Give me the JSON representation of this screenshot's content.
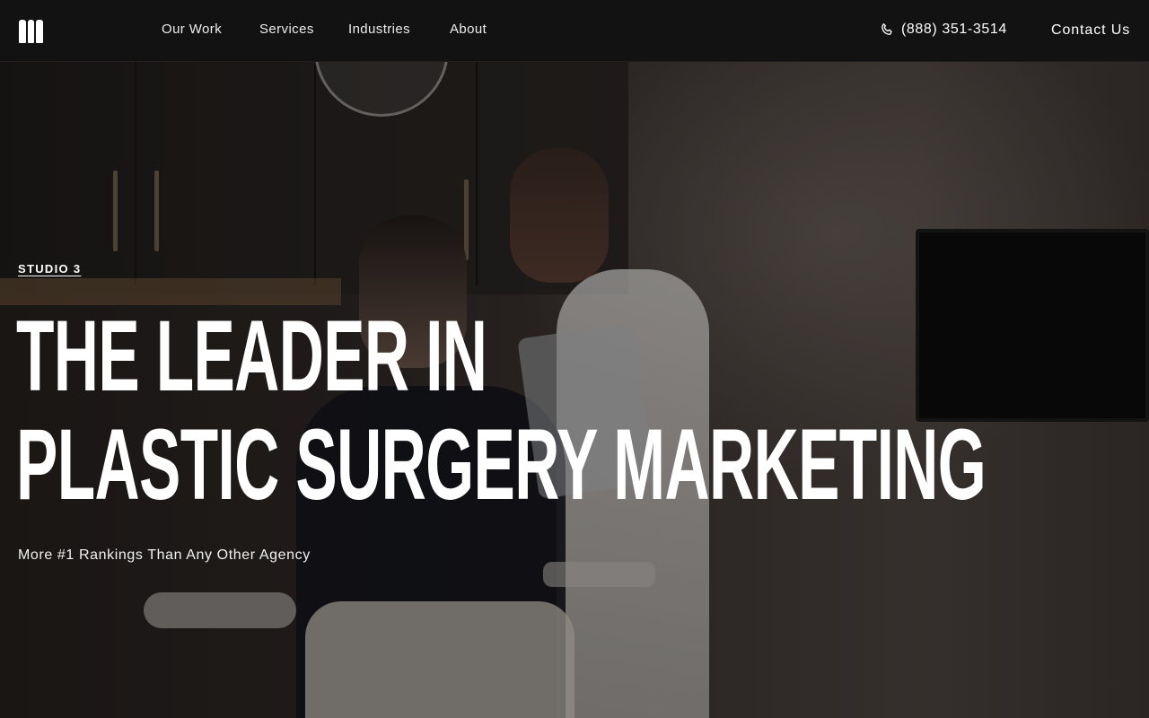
{
  "header": {
    "nav": [
      {
        "label": "Our Work"
      },
      {
        "label": "Services"
      },
      {
        "label": "Industries"
      },
      {
        "label": "About"
      }
    ],
    "phone": "(888) 351-3514",
    "contact_label": "Contact Us"
  },
  "hero": {
    "eyebrow": "STUDIO 3",
    "headline_line1": "THE LEADER IN",
    "headline_line2": "PLASTIC SURGERY MARKETING",
    "subheading": "More #1 Rankings Than Any Other Agency"
  },
  "icons": {
    "logo": "studio3-logo-icon",
    "phone": "phone-icon"
  }
}
